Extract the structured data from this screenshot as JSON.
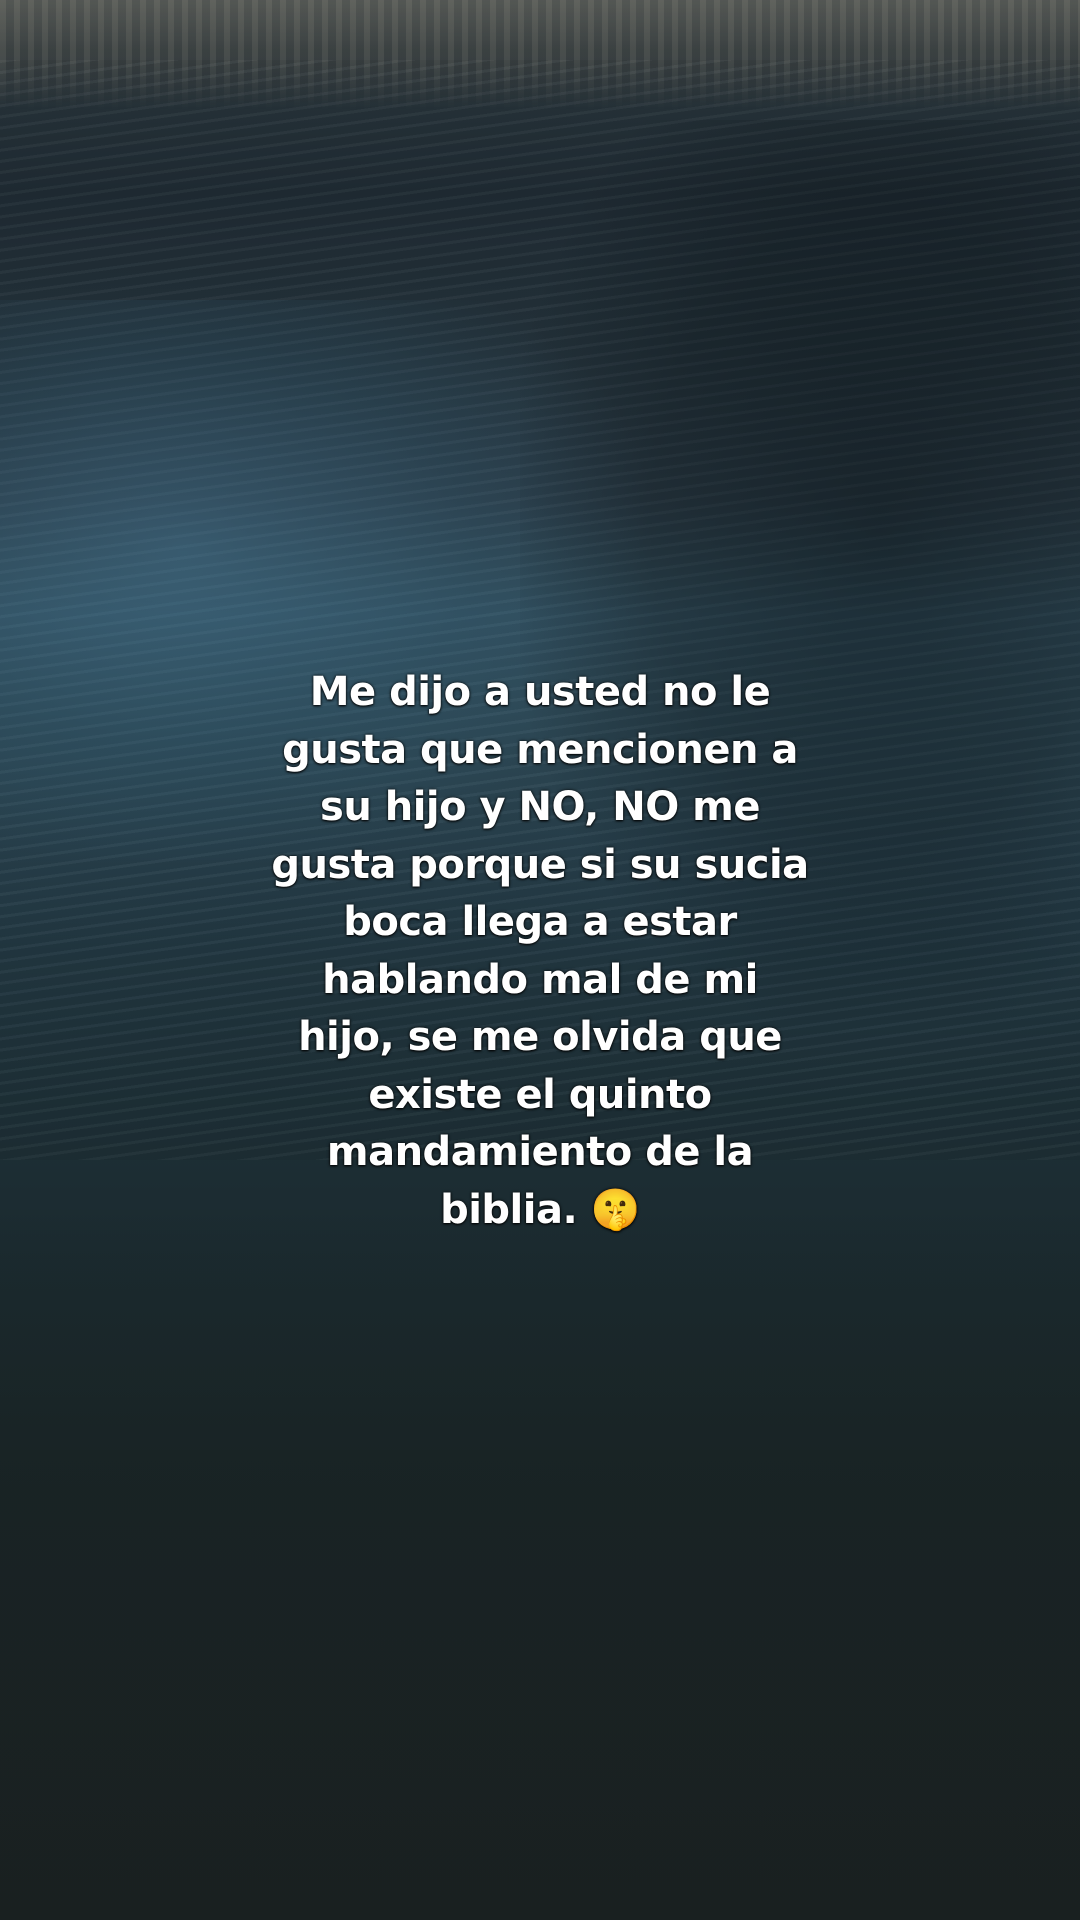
{
  "background": {
    "scene": "lake-water-with-cliff",
    "colors": {
      "water_dark": "#1a2328",
      "water_mid": "#2c4653",
      "sky_reflection": "#33505f",
      "cliff": "#787668",
      "text": "#ffffff"
    }
  },
  "caption": {
    "text": "Me dijo a usted no le\ngusta que mencionen a\nsu hijo y NO, NO me\ngusta porque si su sucia\nboca llega a estar\nhablando mal de mi\nhijo, se me olvida que\nexiste el quinto\nmandamiento de la\nbiblia. 🤫"
  }
}
